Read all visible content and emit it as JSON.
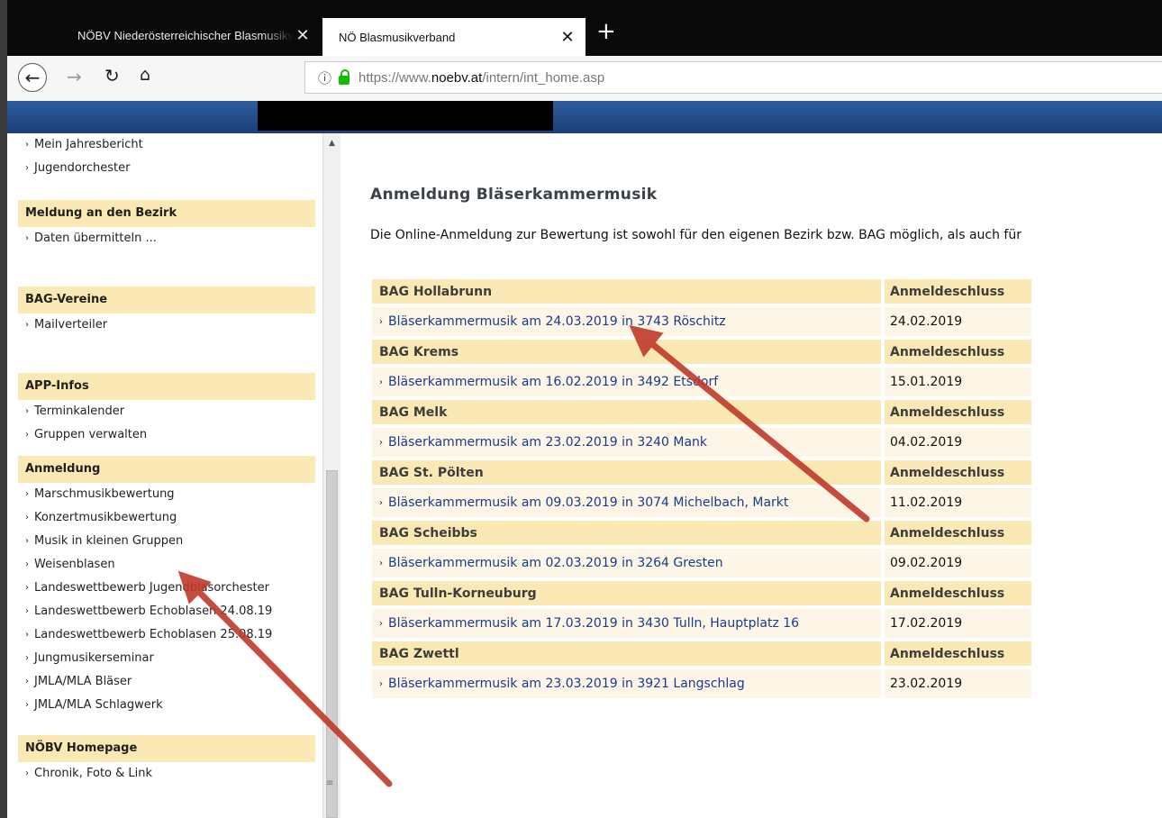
{
  "browser": {
    "tabs": [
      {
        "title": "NÖBV Niederösterreichischer Blasmusikverband",
        "active": false
      },
      {
        "title": "NÖ Blasmusikverband",
        "active": true
      }
    ],
    "close_glyph": "✕",
    "new_tab_glyph": "+",
    "url_prefix": "https://www.",
    "url_domain": "noebv.at",
    "url_path": "/intern/int_home.asp",
    "icons": {
      "back": "←",
      "forward": "→",
      "reload": "C",
      "home": "⌂",
      "info": "ⓘ"
    }
  },
  "sidebar": {
    "marker": "›",
    "top_items": [
      "Mein Jahresbericht",
      "Jugendorchester"
    ],
    "sections": [
      {
        "heading": "Meldung an den Bezirk",
        "items": [
          "Daten übermitteln ..."
        ]
      },
      {
        "heading": "BAG-Vereine",
        "items": [
          "Mailverteiler"
        ]
      },
      {
        "heading": "APP-Infos",
        "items": [
          "Terminkalender",
          "Gruppen verwalten"
        ]
      },
      {
        "heading": "Anmeldung",
        "items": [
          "Marschmusikbewertung",
          "Konzertmusikbewertung",
          "Musik in kleinen Gruppen",
          "Weisenblasen",
          "Landeswettbewerb Jugendblasorchester",
          "Landeswettbewerb Echoblasen 24.08.19",
          "Landeswettbewerb Echoblasen 25.08.19",
          "Jungmusikerseminar",
          "JMLA/MLA Bläser",
          "JMLA/MLA Schlagwerk"
        ]
      },
      {
        "heading": "NÖBV Homepage",
        "items": [
          "Chronik, Foto & Link"
        ]
      }
    ]
  },
  "main": {
    "title": "Anmeldung Bläserkammermusik",
    "intro": "Die Online-Anmeldung zur Bewertung ist sowohl für den eigenen Bezirk bzw. BAG möglich, als auch für",
    "deadline_header": "Anmeldeschluss",
    "groups": [
      {
        "name": "BAG Hollabrunn",
        "event": "Bläserkammermusik am 24.03.2019 in 3743 Röschitz",
        "deadline": "24.02.2019"
      },
      {
        "name": "BAG Krems",
        "event": "Bläserkammermusik am 16.02.2019 in 3492 Etsdorf",
        "deadline": "15.01.2019"
      },
      {
        "name": "BAG Melk",
        "event": "Bläserkammermusik am 23.02.2019 in 3240 Mank",
        "deadline": "04.02.2019"
      },
      {
        "name": "BAG St. Pölten",
        "event": "Bläserkammermusik am 09.03.2019 in 3074 Michelbach, Markt",
        "deadline": "11.02.2019"
      },
      {
        "name": "BAG Scheibbs",
        "event": "Bläserkammermusik am 02.03.2019 in 3264 Gresten",
        "deadline": "09.02.2019"
      },
      {
        "name": "BAG Tulln-Korneuburg",
        "event": "Bläserkammermusik am 17.03.2019 in 3430 Tulln, Hauptplatz 16",
        "deadline": "17.02.2019"
      },
      {
        "name": "BAG Zwettl",
        "event": "Bläserkammermusik am 23.03.2019 in 3921 Langschlag",
        "deadline": "23.02.2019"
      }
    ]
  },
  "colors": {
    "header_bg": "#fae9b4",
    "row_bg": "#fdf6e6",
    "link": "#1a3b8b",
    "banner": "#2e5c9e",
    "arrow": "#c0392b"
  }
}
